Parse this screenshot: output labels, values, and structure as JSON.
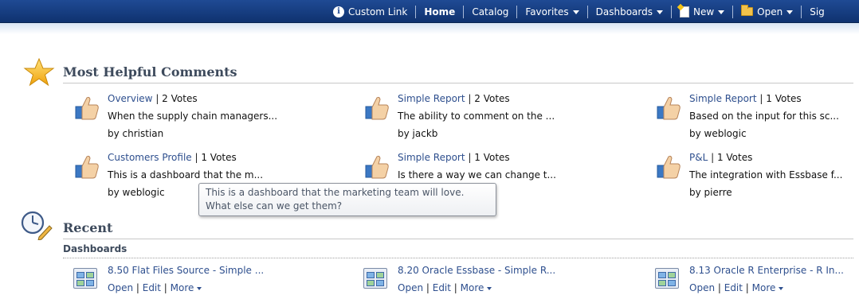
{
  "nav": {
    "custom_link": "Custom Link",
    "home": "Home",
    "catalog": "Catalog",
    "favorites": "Favorites",
    "dashboards": "Dashboards",
    "new": "New",
    "open": "Open",
    "sign": "Sig"
  },
  "helpful": {
    "title": "Most Helpful Comments",
    "comments": [
      {
        "link": "Overview",
        "votes": "2 Votes",
        "text": "When the supply chain managers...",
        "author": "by christian"
      },
      {
        "link": "Simple Report",
        "votes": "2 Votes",
        "text": "The ability to comment on the ...",
        "author": "by jackb"
      },
      {
        "link": "Simple Report",
        "votes": "1 Votes",
        "text": "Based on the input for this sc...",
        "author": "by weblogic"
      },
      {
        "link": "Customers Profile",
        "votes": "1 Votes",
        "text": "This is a dashboard that the m...",
        "author": "by weblogic"
      },
      {
        "link": "Simple Report",
        "votes": "1 Votes",
        "text": "Is there a way we can change t...",
        "author": ""
      },
      {
        "link": "P&L",
        "votes": "1 Votes",
        "text": "The integration with Essbase f...",
        "author": "by pierre"
      }
    ]
  },
  "tooltip": {
    "line1": "This is a dashboard that the marketing team will love.",
    "line2": "What else can we get them?"
  },
  "recent": {
    "title": "Recent",
    "subhead": "Dashboards",
    "items": [
      {
        "title": "8.50 Flat Files Source - Simple ...",
        "open": "Open",
        "edit": "Edit",
        "more": "More"
      },
      {
        "title": "8.20 Oracle Essbase - Simple R...",
        "open": "Open",
        "edit": "Edit",
        "more": "More"
      },
      {
        "title": "8.13 Oracle R Enterprise - R In...",
        "open": "Open",
        "edit": "Edit",
        "more": "More"
      }
    ]
  },
  "colors": {
    "nav_bg": "#1f4a94",
    "link": "#2e4f8e",
    "header_text": "#3d4a5c"
  },
  "icons": [
    "info-icon",
    "new-document-icon",
    "folder-icon",
    "star-icon",
    "thumbs-up-icon",
    "clock-pencil-icon",
    "dashboard-icon"
  ]
}
